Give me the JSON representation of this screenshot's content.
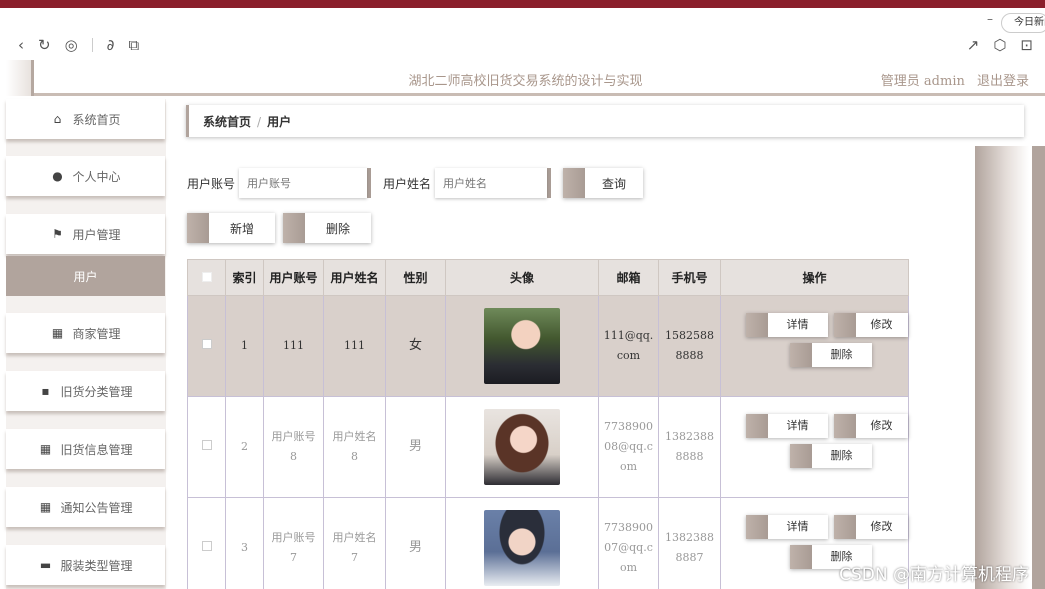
{
  "browser": {
    "today_label": "今日新闻",
    "minimize": "–"
  },
  "header": {
    "title": "湖北二师高校旧货交易系统的设计与实现",
    "user": "管理员 admin",
    "logout": "退出登录"
  },
  "sidebar": {
    "items": [
      {
        "label": "系统首页",
        "icon": "home-icon"
      },
      {
        "label": "个人中心",
        "icon": "person-icon"
      },
      {
        "label": "用户管理",
        "icon": "flag-icon"
      },
      {
        "label": "用户",
        "icon": ""
      },
      {
        "label": "商家管理",
        "icon": "grid-icon"
      },
      {
        "label": "旧货分类管理",
        "icon": "chat-icon"
      },
      {
        "label": "旧货信息管理",
        "icon": "grid-icon"
      },
      {
        "label": "通知公告管理",
        "icon": "grid-icon"
      },
      {
        "label": "服装类型管理",
        "icon": "monitor-icon"
      }
    ]
  },
  "breadcrumb": {
    "home": "系统首页",
    "sep": "/",
    "current": "用户"
  },
  "search": {
    "account_label": "用户账号",
    "account_placeholder": "用户账号",
    "name_label": "用户姓名",
    "name_placeholder": "用户姓名",
    "query_btn": "查询"
  },
  "actions": {
    "add": "新增",
    "delete": "删除"
  },
  "table": {
    "headers": [
      "",
      "索引",
      "用户账号",
      "用户姓名",
      "性别",
      "头像",
      "邮箱",
      "手机号",
      "操作"
    ],
    "rows": [
      {
        "index": "1",
        "account": "111",
        "name": "111",
        "gender": "女",
        "email": "111@qq.com",
        "phone": "15825888888"
      },
      {
        "index": "2",
        "account": "用户账号8",
        "name": "用户姓名8",
        "gender": "男",
        "email": "773890008@qq.com",
        "phone": "13823888888"
      },
      {
        "index": "3",
        "account": "用户账号7",
        "name": "用户姓名7",
        "gender": "男",
        "email": "773890007@qq.com",
        "phone": "13823888887"
      }
    ],
    "op_detail": "详情",
    "op_edit": "修改",
    "op_delete": "删除"
  },
  "watermark": "CSDN @南方计算机程序"
}
